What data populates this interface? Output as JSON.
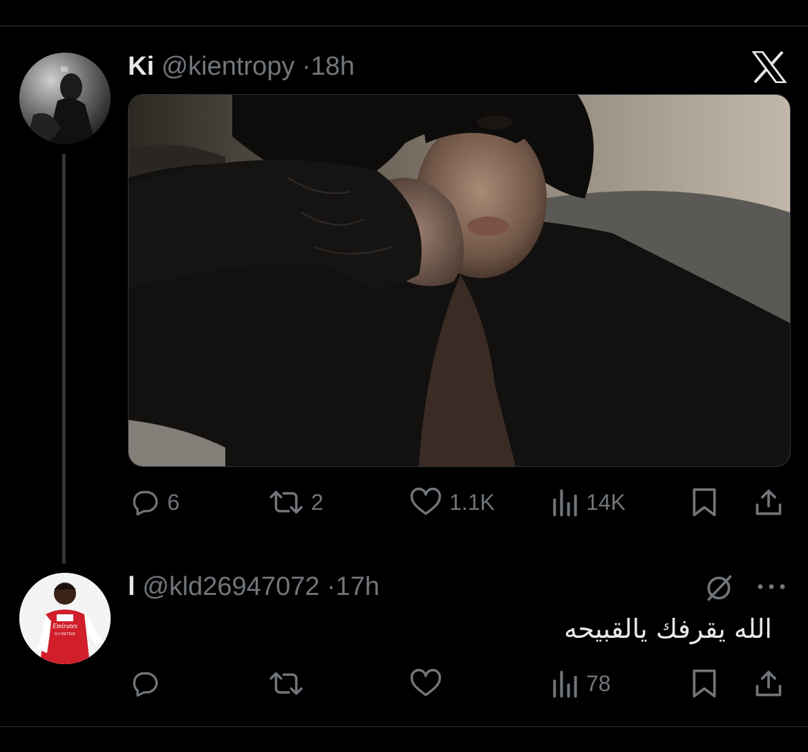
{
  "tweet": {
    "display_name": "Ki",
    "handle": "@kientropy",
    "separator": "·",
    "time": "18h",
    "logo_icon": "x-logo-icon",
    "photo_icon": "selfie-photo",
    "actions": {
      "reply_count": "6",
      "retweet_count": "2",
      "like_count": "1.1K",
      "views_count": "14K"
    }
  },
  "reply": {
    "display_name": "l",
    "handle": "@kld26947072",
    "separator": "·",
    "time": "17h",
    "text": "الله يقرفك يالقبيحه",
    "avatar_jersey_text": "Emirates",
    "avatar_jersey_subtext": "FLY BETTER",
    "actions": {
      "views_count": "78"
    }
  },
  "colors": {
    "background": "#000000",
    "text": "#e7e9ea",
    "muted": "#71767b",
    "divider": "#2f3336"
  }
}
